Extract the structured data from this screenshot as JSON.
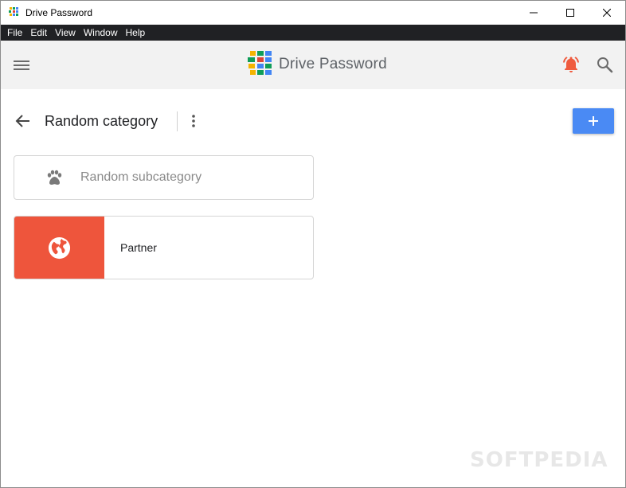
{
  "window": {
    "title": "Drive Password"
  },
  "menubar": {
    "items": [
      "File",
      "Edit",
      "View",
      "Window",
      "Help"
    ]
  },
  "header": {
    "brand": "Drive Password",
    "icons": [
      "menu-icon",
      "logo",
      "notification-bell-icon",
      "search-icon"
    ],
    "bell_color": "#ef5b3e"
  },
  "main": {
    "title": "Random category",
    "add_button_color": "#4a8af4",
    "subcategories": [
      {
        "label": "Random subcategory",
        "icon": "paw-icon"
      }
    ],
    "items": [
      {
        "label": "Partner",
        "icon": "globe-icon",
        "color": "#ee553c"
      }
    ]
  },
  "watermark": "SOFTPEDIA"
}
